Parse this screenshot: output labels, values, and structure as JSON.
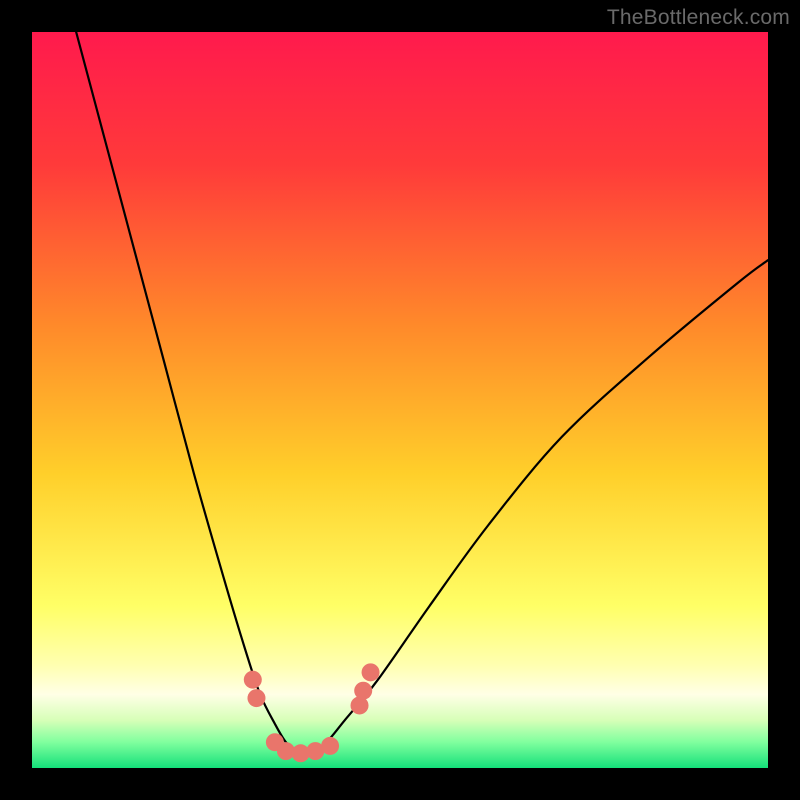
{
  "watermark": "TheBottleneck.com",
  "chart_data": {
    "type": "line",
    "title": "",
    "xlabel": "",
    "ylabel": "",
    "xlim": [
      0,
      100
    ],
    "ylim": [
      0,
      100
    ],
    "background": {
      "description": "vertical gradient red-orange-yellow-green",
      "stops": [
        {
          "offset": 0.0,
          "color": "#ff1a4d"
        },
        {
          "offset": 0.18,
          "color": "#ff3a3a"
        },
        {
          "offset": 0.4,
          "color": "#ff8a2a"
        },
        {
          "offset": 0.6,
          "color": "#ffcf2a"
        },
        {
          "offset": 0.78,
          "color": "#ffff66"
        },
        {
          "offset": 0.86,
          "color": "#ffffb0"
        },
        {
          "offset": 0.9,
          "color": "#ffffe6"
        },
        {
          "offset": 0.935,
          "color": "#d7ffb8"
        },
        {
          "offset": 0.965,
          "color": "#80ff9e"
        },
        {
          "offset": 1.0,
          "color": "#14e07a"
        }
      ]
    },
    "series": [
      {
        "name": "bottleneck-curve",
        "color": "#000000",
        "x": [
          6,
          10,
          14,
          18,
          22,
          26,
          29,
          31,
          33,
          34.5,
          36,
          38,
          40,
          42.5,
          47,
          54,
          62,
          72,
          84,
          96,
          100
        ],
        "y": [
          100,
          85,
          70,
          55,
          40,
          26,
          16,
          10,
          6,
          3.5,
          2.2,
          2.2,
          3.5,
          6.5,
          12,
          22,
          33,
          45,
          56,
          66,
          69
        ]
      }
    ],
    "markers": {
      "name": "highlight-dots",
      "color": "#e9756b",
      "radius_px": 9,
      "points": [
        {
          "x": 30.0,
          "y": 12.0
        },
        {
          "x": 30.5,
          "y": 9.5
        },
        {
          "x": 33.0,
          "y": 3.5
        },
        {
          "x": 34.5,
          "y": 2.3
        },
        {
          "x": 36.5,
          "y": 2.0
        },
        {
          "x": 38.5,
          "y": 2.3
        },
        {
          "x": 40.5,
          "y": 3.0
        },
        {
          "x": 44.5,
          "y": 8.5
        },
        {
          "x": 45.0,
          "y": 10.5
        },
        {
          "x": 46.0,
          "y": 13.0
        }
      ]
    }
  }
}
